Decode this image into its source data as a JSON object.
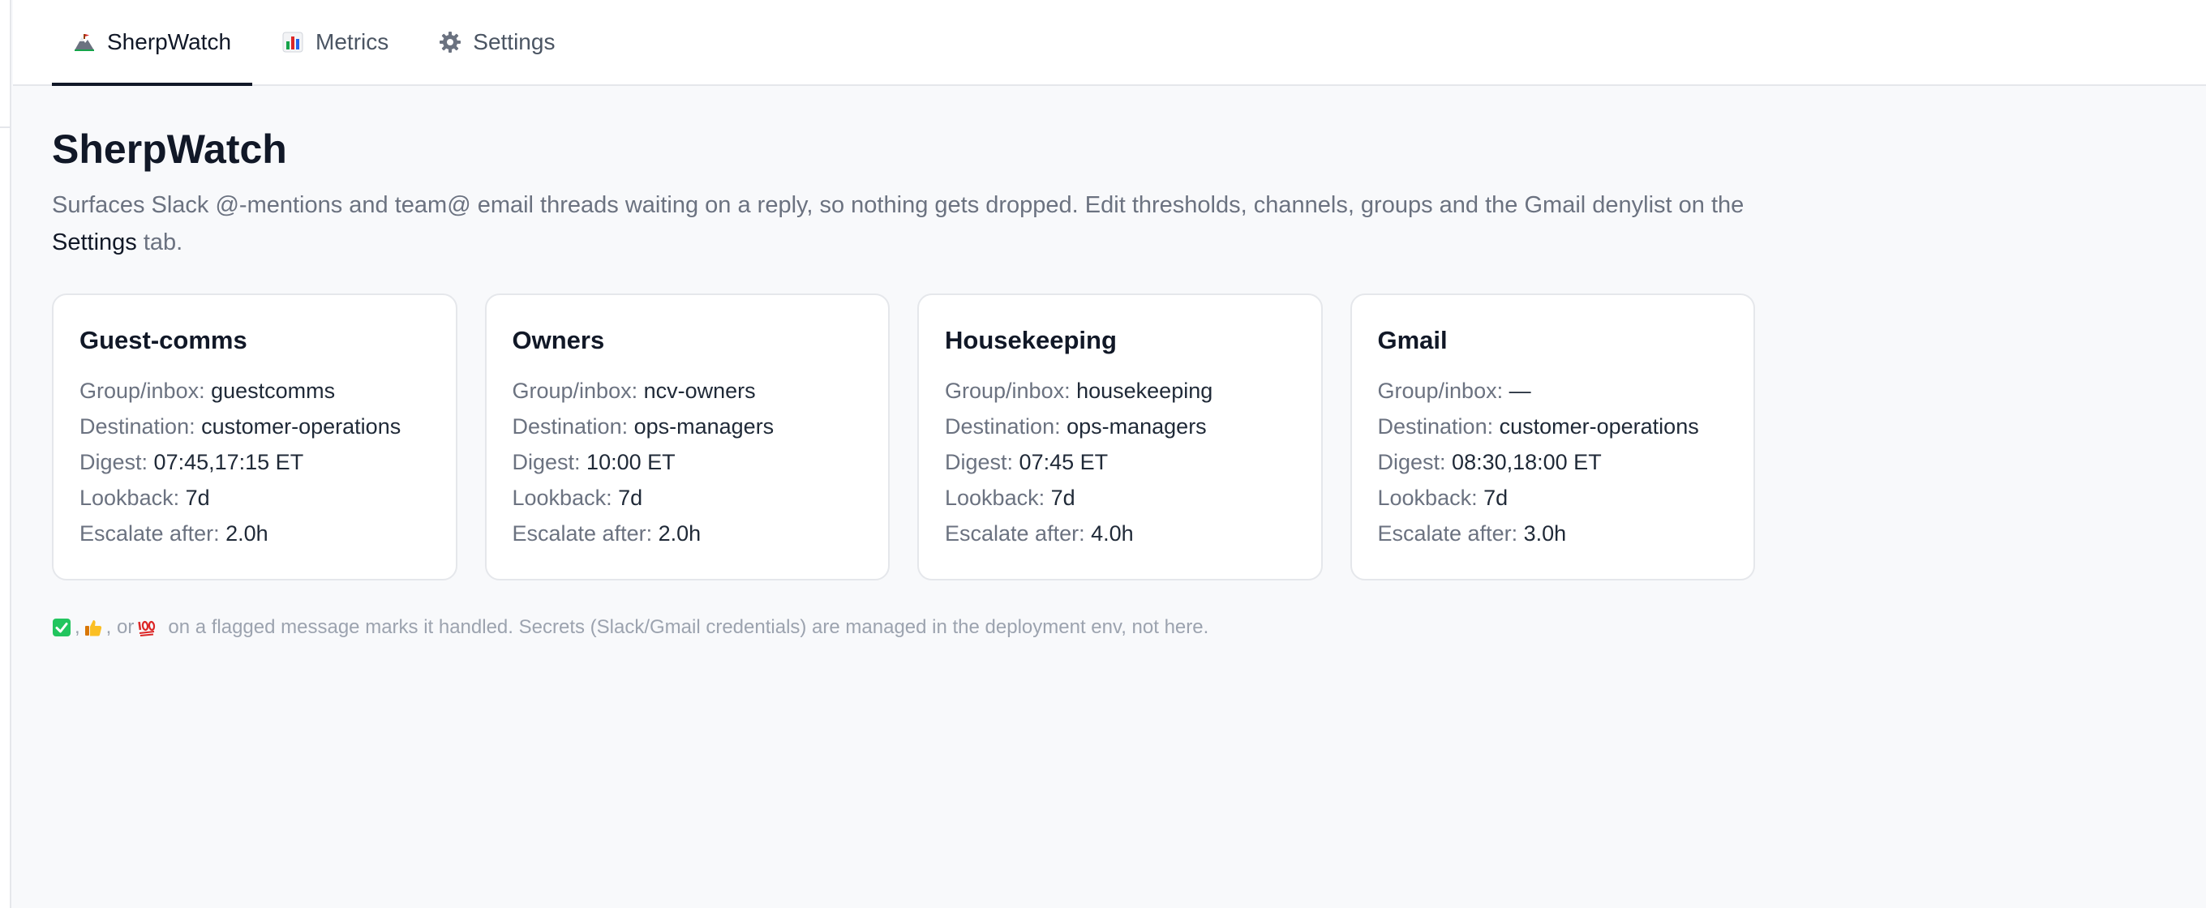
{
  "tabs": [
    {
      "label": "SherpWatch",
      "icon": "mountain-icon",
      "active": true
    },
    {
      "label": "Metrics",
      "icon": "bar-chart-icon",
      "active": false
    },
    {
      "label": "Settings",
      "icon": "gear-icon",
      "active": false
    }
  ],
  "page": {
    "title": "SherpWatch",
    "description_before": "Surfaces Slack @-mentions and team@ email threads waiting on a reply, so nothing gets dropped. Edit thresholds, channels, groups and the Gmail denylist on the ",
    "description_link": "Settings",
    "description_after": " tab."
  },
  "labels": {
    "group": "Group/inbox: ",
    "destination": "Destination: ",
    "digest": "Digest: ",
    "lookback": "Lookback: ",
    "escalate": "Escalate after: "
  },
  "cards": [
    {
      "title": "Guest-comms",
      "group": "guestcomms",
      "destination": "customer-operations",
      "digest": "07:45,17:15 ET",
      "lookback": "7d",
      "escalate": "2.0h"
    },
    {
      "title": "Owners",
      "group": "ncv-owners",
      "destination": "ops-managers",
      "digest": "10:00 ET",
      "lookback": "7d",
      "escalate": "2.0h"
    },
    {
      "title": "Housekeeping",
      "group": "housekeeping",
      "destination": "ops-managers",
      "digest": "07:45 ET",
      "lookback": "7d",
      "escalate": "4.0h"
    },
    {
      "title": "Gmail",
      "group": "—",
      "destination": "customer-operations",
      "digest": "08:30,18:00 ET",
      "lookback": "7d",
      "escalate": "3.0h"
    }
  ],
  "footnote": {
    "icons": [
      "check-mark-icon",
      "thumbs-up-icon",
      "hundred-points-icon"
    ],
    "sep1": ",",
    "sep2": ", or",
    "text": "on a flagged message marks it handled. Secrets (Slack/Gmail credentials) are managed in the deployment env, not here."
  },
  "colors": {
    "accent": "#111827",
    "muted": "#6b7280",
    "check_green": "#22c55e",
    "hundred_red": "#dc2626"
  }
}
